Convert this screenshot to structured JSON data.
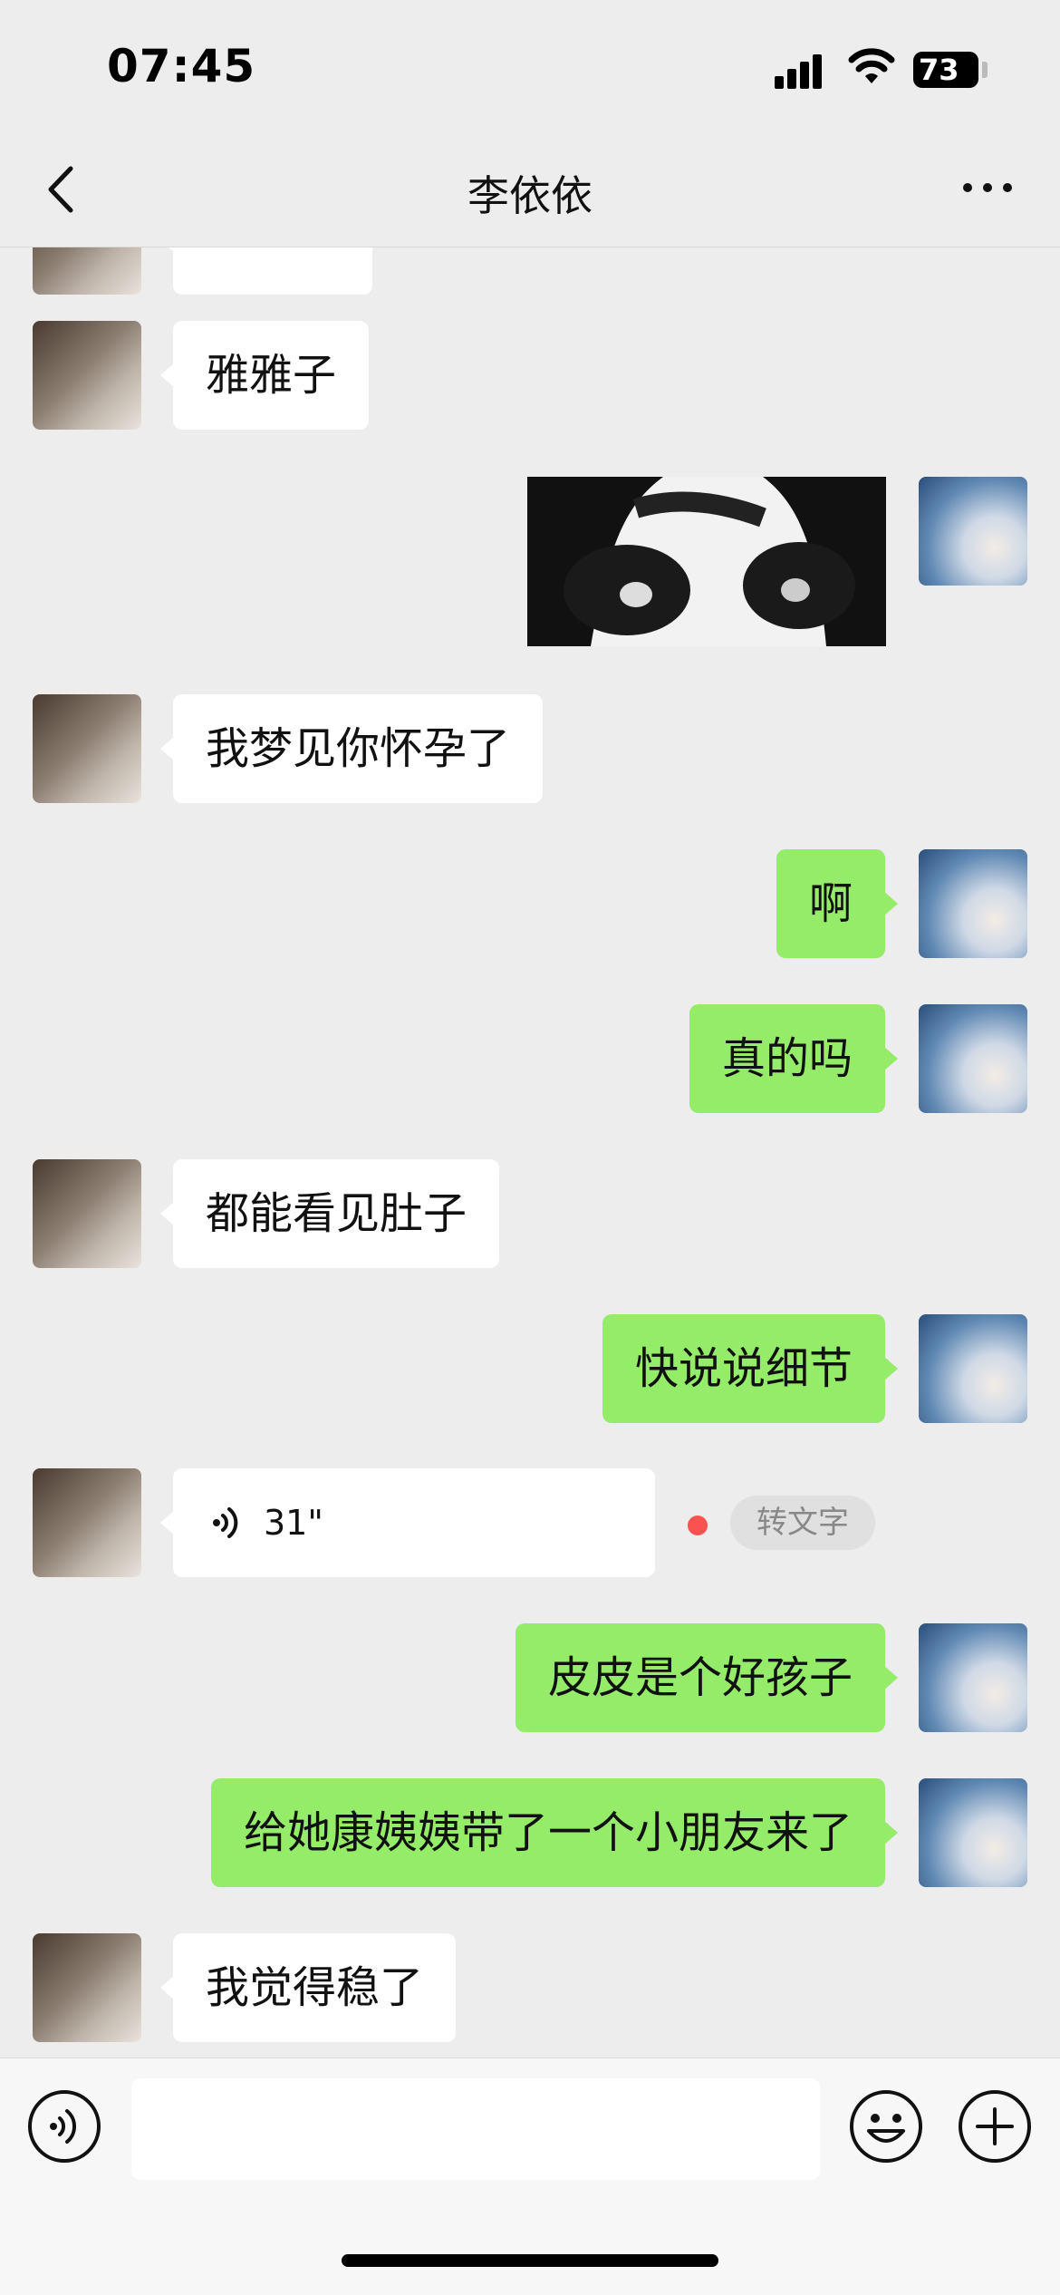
{
  "status_bar": {
    "time": "07:45",
    "battery": "73"
  },
  "nav": {
    "title": "李依依"
  },
  "messages": [
    {
      "side": "in",
      "type": "text",
      "text": "雅雅子"
    },
    {
      "side": "out",
      "type": "sticker"
    },
    {
      "side": "in",
      "type": "text",
      "text": "我梦见你怀孕了"
    },
    {
      "side": "out",
      "type": "text",
      "text": "啊"
    },
    {
      "side": "out",
      "type": "text",
      "text": "真的吗"
    },
    {
      "side": "in",
      "type": "text",
      "text": "都能看见肚子"
    },
    {
      "side": "out",
      "type": "text",
      "text": "快说说细节"
    },
    {
      "side": "in",
      "type": "voice",
      "duration": "31\"",
      "action": "转文字"
    },
    {
      "side": "out",
      "type": "text",
      "text": "皮皮是个好孩子"
    },
    {
      "side": "out",
      "type": "text",
      "text": "给她康姨姨带了一个小朋友来了"
    },
    {
      "side": "in",
      "type": "text",
      "text": "我觉得稳了"
    }
  ],
  "input": {
    "value": ""
  },
  "colors": {
    "background": "#ededed",
    "bubble_out": "#95ec69",
    "bubble_in": "#ffffff",
    "unread_dot": "#fa5151"
  },
  "icons": [
    "back-icon",
    "more-icon",
    "voice-wave-icon",
    "emoji-icon",
    "plus-icon",
    "signal-icon",
    "wifi-icon",
    "battery-icon"
  ]
}
